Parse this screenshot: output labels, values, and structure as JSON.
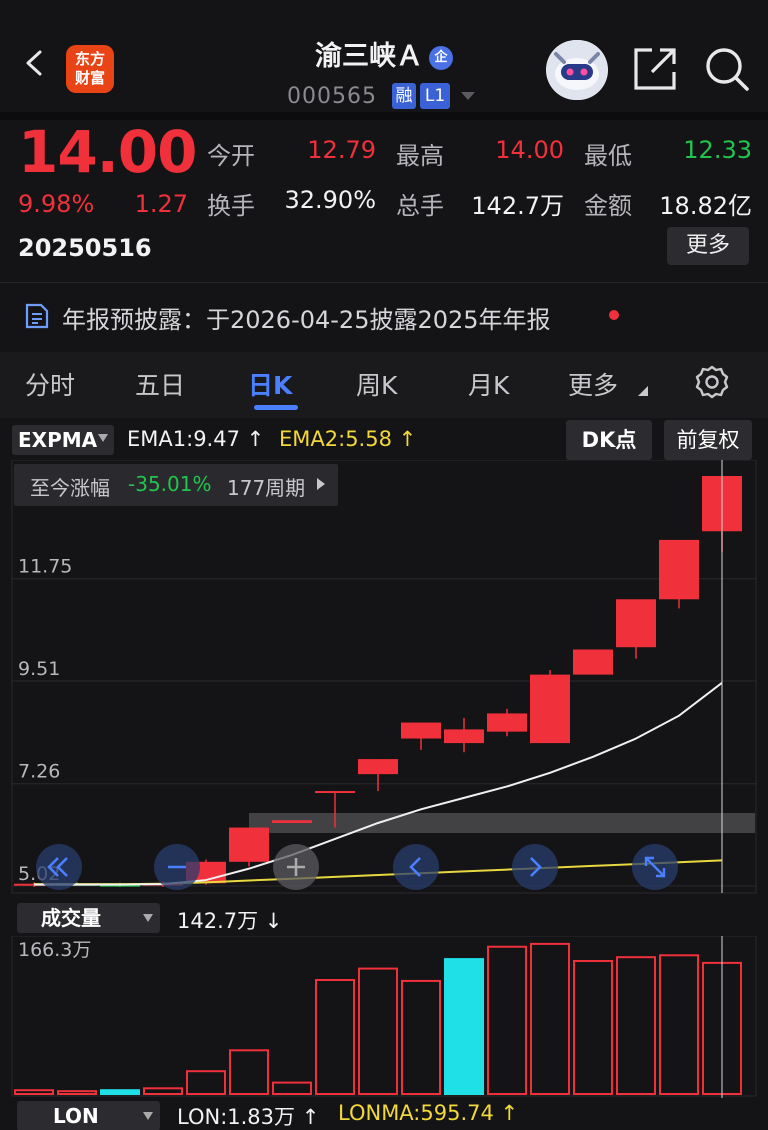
{
  "header": {
    "logo_text": "东方财富",
    "stock_name": "渝三峡Ａ",
    "badge": "企",
    "code": "000565",
    "tag_margin": "融",
    "tag_level": "L1",
    "icons": [
      "back-arrow-icon",
      "share-icon",
      "search-icon",
      "robot-avatar-icon"
    ]
  },
  "quote": {
    "price": "14.00",
    "change_pct": "9.98%",
    "change": "1.27",
    "date": "20250516",
    "fields": [
      {
        "label": "今开",
        "value": "12.79",
        "color": "red"
      },
      {
        "label": "最高",
        "value": "14.00",
        "color": "red"
      },
      {
        "label": "最低",
        "value": "12.33",
        "color": "green"
      },
      {
        "label": "换手",
        "value": "32.90%",
        "color": "white"
      },
      {
        "label": "总手",
        "value": "142.7万",
        "color": "white"
      },
      {
        "label": "金额",
        "value": "18.82亿",
        "color": "white"
      }
    ],
    "more_label": "更多"
  },
  "notice": {
    "text": "年报预披露：于2026-04-25披露2025年年报"
  },
  "tabs": {
    "items": [
      "分时",
      "五日",
      "日K",
      "周K",
      "月K",
      "更多"
    ],
    "active": "日K"
  },
  "main_indicator": {
    "name": "EXPMA",
    "ema1": "EMA1:9.47",
    "ema2": "EMA2:5.58",
    "dk_label": "DK点",
    "fq_label": "前复权",
    "range_label": "至今涨幅",
    "range_value": "-35.01%",
    "range_period": "177周期"
  },
  "volume_indicator": {
    "name": "成交量",
    "value": "142.7万",
    "max_label": "166.3万"
  },
  "lon_indicator": {
    "name": "LON",
    "lon": "LON:1.83万",
    "lonma": "LONMA:595.74"
  },
  "colors": {
    "up": "#f0303a",
    "down": "#22c44e",
    "volume_down": "#1ee0e6",
    "ema1": "#f0f0f0",
    "ema2": "#e8d840",
    "accent": "#4a80ff"
  },
  "chart_data": [
    {
      "type": "candlestick",
      "y_ticks": [
        "11.75",
        "9.51",
        "7.26",
        "5.02"
      ],
      "ylim": [
        5.02,
        14.0
      ],
      "candles": [
        {
          "o": 5.05,
          "h": 5.1,
          "l": 5.0,
          "c": 5.07
        },
        {
          "o": 5.07,
          "h": 5.1,
          "l": 5.03,
          "c": 5.05
        },
        {
          "o": 5.05,
          "h": 5.09,
          "l": 5.0,
          "c": 5.03
        },
        {
          "o": 5.03,
          "h": 5.12,
          "l": 5.0,
          "c": 5.08
        },
        {
          "o": 5.08,
          "h": 5.6,
          "l": 5.05,
          "c": 5.55
        },
        {
          "o": 5.55,
          "h": 6.1,
          "l": 5.45,
          "c": 6.3
        },
        {
          "o": 6.4,
          "h": 6.46,
          "l": 6.4,
          "c": 6.46
        },
        {
          "o": 7.1,
          "h": 7.1,
          "l": 6.3,
          "c": 7.1
        },
        {
          "o": 7.47,
          "h": 7.8,
          "l": 7.1,
          "c": 7.8
        },
        {
          "o": 8.25,
          "h": 8.55,
          "l": 8.0,
          "c": 8.6
        },
        {
          "o": 8.15,
          "h": 8.7,
          "l": 7.95,
          "c": 8.45
        },
        {
          "o": 8.4,
          "h": 8.9,
          "l": 8.3,
          "c": 8.8
        },
        {
          "o": 8.15,
          "h": 9.75,
          "l": 8.15,
          "c": 9.65
        },
        {
          "o": 9.65,
          "h": 10.2,
          "l": 9.65,
          "c": 10.2
        },
        {
          "o": 10.25,
          "h": 11.0,
          "l": 10.0,
          "c": 11.3
        },
        {
          "o": 11.3,
          "h": 12.15,
          "l": 11.1,
          "c": 12.6
        },
        {
          "o": 12.79,
          "h": 14.0,
          "l": 12.33,
          "c": 14.0
        }
      ],
      "ema1": [
        5.05,
        5.05,
        5.05,
        5.06,
        5.15,
        5.4,
        5.7,
        6.05,
        6.4,
        6.7,
        6.95,
        7.2,
        7.5,
        7.85,
        8.25,
        8.75,
        9.47
      ],
      "ema2": [
        5.06,
        5.06,
        5.06,
        5.07,
        5.1,
        5.14,
        5.18,
        5.22,
        5.26,
        5.3,
        5.34,
        5.38,
        5.42,
        5.46,
        5.5,
        5.54,
        5.58
      ]
    },
    {
      "type": "bar",
      "title": "成交量",
      "unit": "万",
      "ylim": [
        0,
        166.3
      ],
      "values": [
        4,
        3,
        4,
        6,
        24,
        46,
        12,
        120,
        132,
        119,
        142,
        155,
        158,
        140,
        144,
        146,
        138
      ],
      "colors": [
        "up",
        "up",
        "down",
        "up",
        "up",
        "up",
        "up",
        "up",
        "up",
        "up",
        "down",
        "up",
        "up",
        "up",
        "up",
        "up",
        "up"
      ]
    }
  ]
}
